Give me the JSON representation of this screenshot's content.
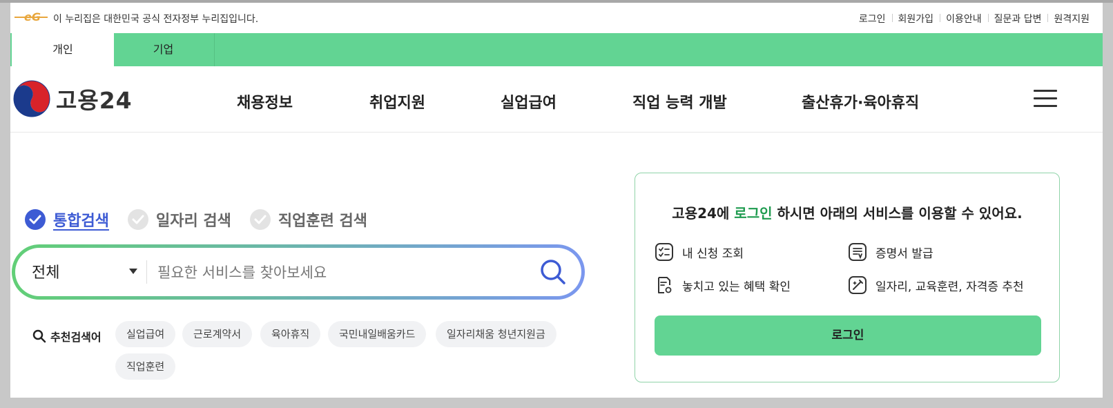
{
  "gov_banner": {
    "notice": "이 누리집은 대한민국 공식 전자정부 누리집입니다.",
    "links": [
      "로그인",
      "회원가입",
      "이용안내",
      "질문과 답변",
      "원격지원"
    ]
  },
  "user_tabs": [
    "개인",
    "기업"
  ],
  "header": {
    "brand": "고용24",
    "nav": [
      "채용정보",
      "취업지원",
      "실업급여",
      "직업 능력 개발",
      "출산휴가·육아휴직"
    ]
  },
  "search": {
    "types": [
      "통합검색",
      "일자리 검색",
      "직업훈련 검색"
    ],
    "category": "전체",
    "placeholder": "필요한 서비스를 찾아보세요",
    "recommend_label": "추천검색어",
    "keywords": [
      "실업급여",
      "근로계약서",
      "육아휴직",
      "국민내일배움카드",
      "일자리채움 청년지원금",
      "직업훈련"
    ]
  },
  "login_panel": {
    "msg_prefix": "고용24에 ",
    "msg_highlight": "로그인",
    "msg_suffix": " 하시면 아래의 서비스를 이용할 수 있어요.",
    "services": [
      "내 신청 조회",
      "증명서 발급",
      "놓치고 있는 혜택 확인",
      "일자리, 교육훈련, 자격증 추천"
    ],
    "button": "로그인"
  },
  "colors": {
    "brand_green": "#62d493",
    "active_blue": "#3d5bd4",
    "highlight_green": "#1e9b4f"
  }
}
